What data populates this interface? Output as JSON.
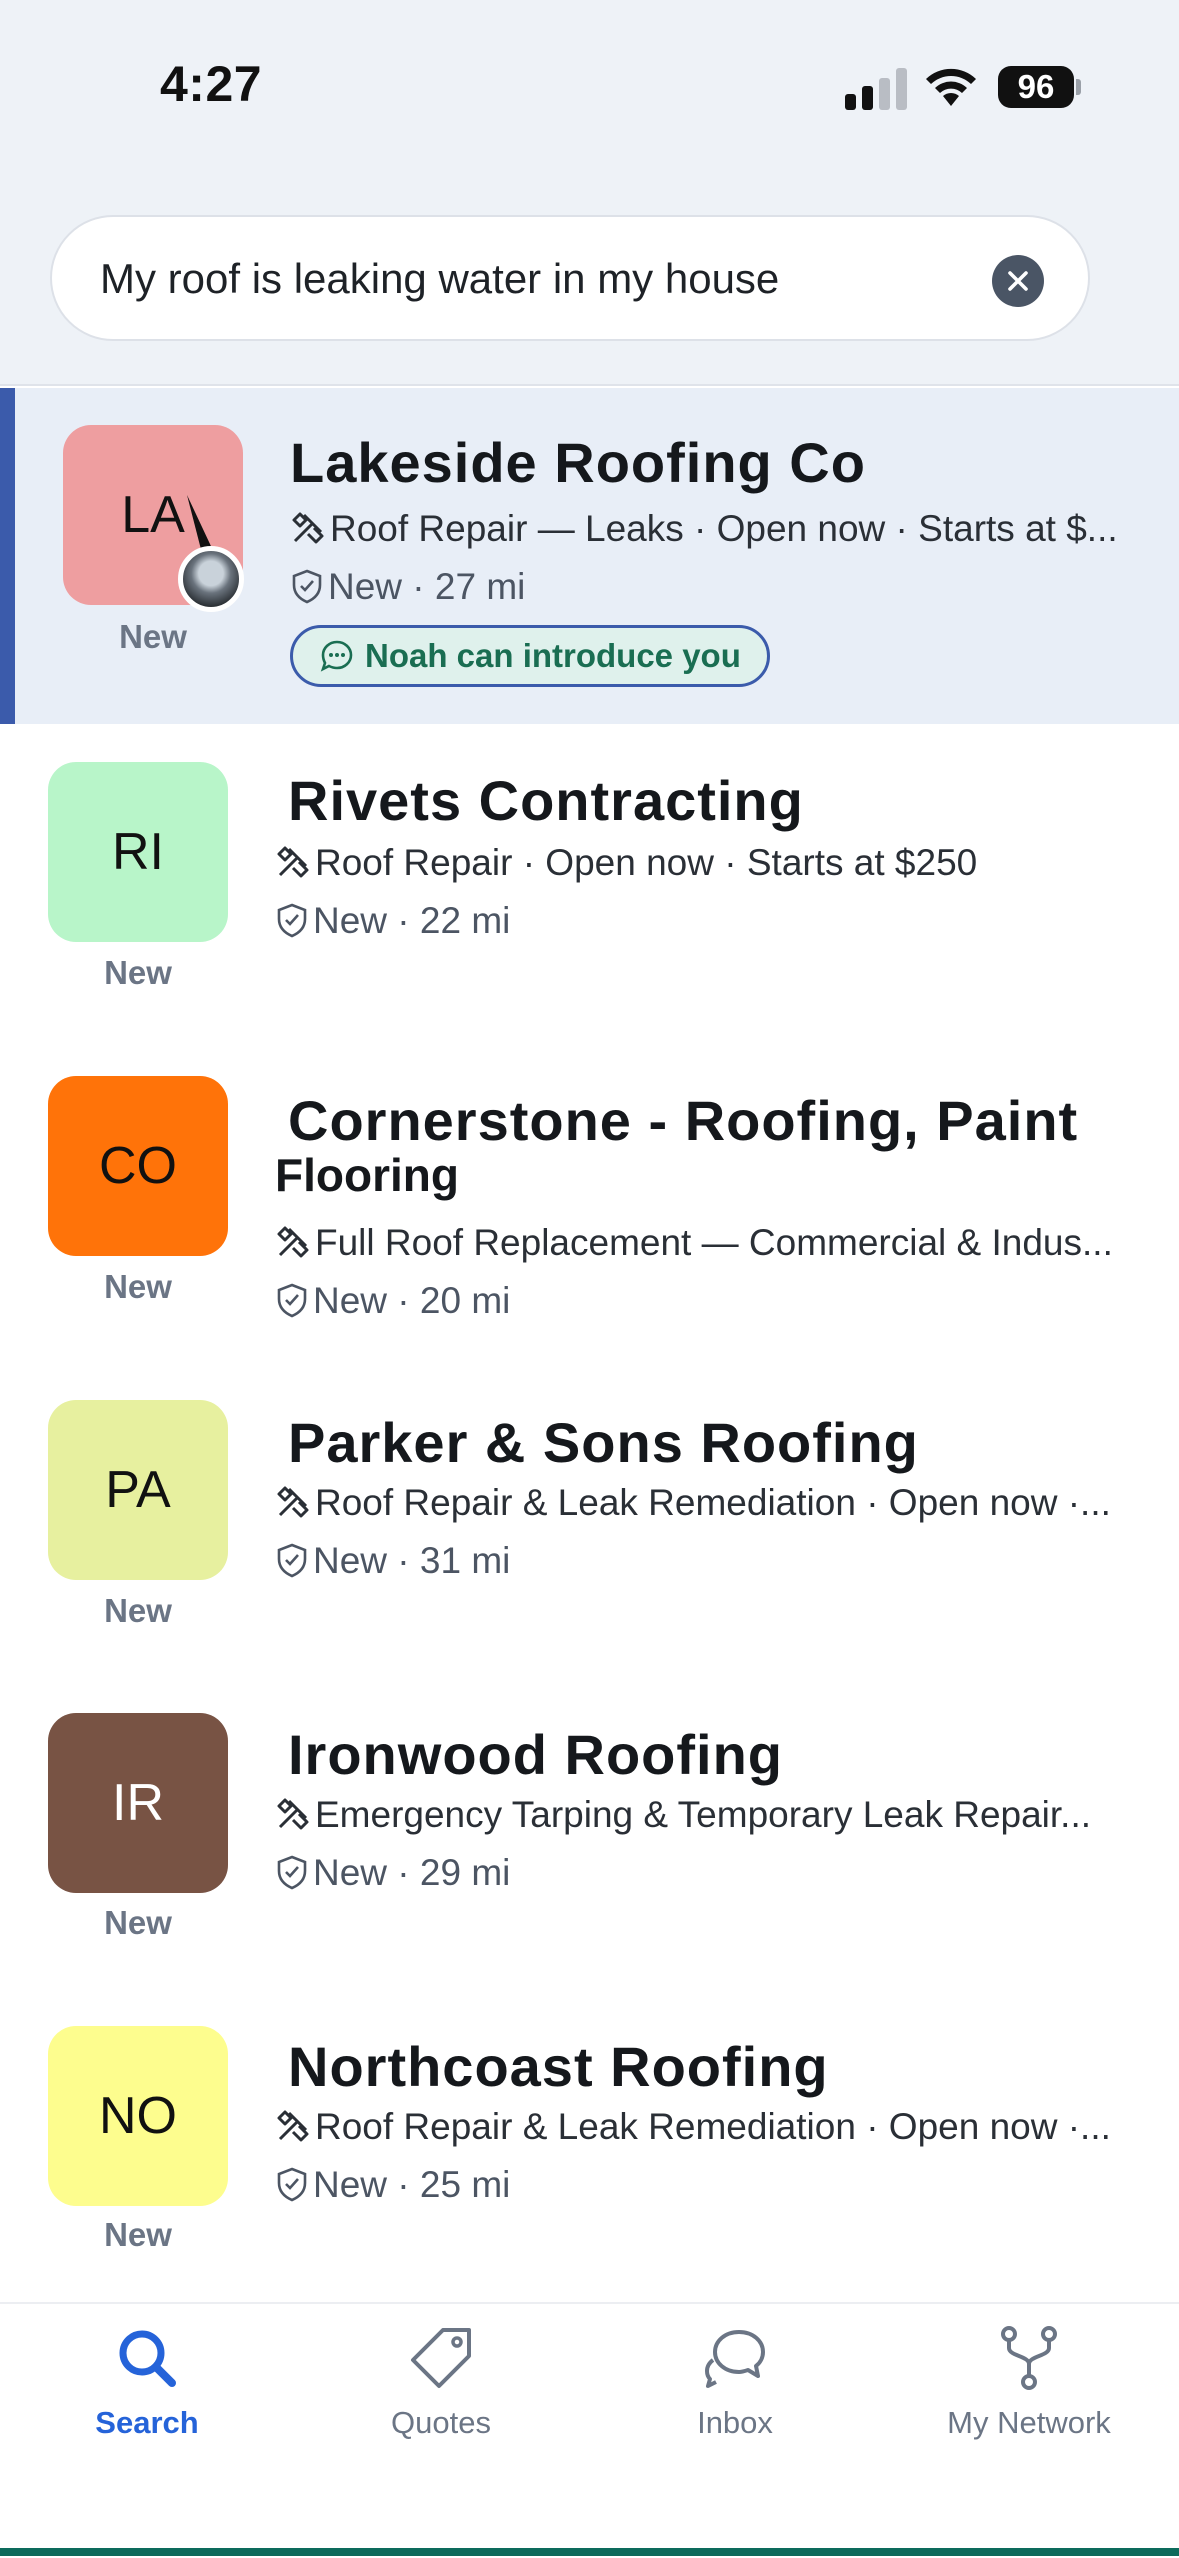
{
  "status_bar": {
    "time": "4:27",
    "battery": "96"
  },
  "search": {
    "query": "My roof is leaking water in my house"
  },
  "results": [
    {
      "initials": "LA",
      "avatar_color": "#ee9ea0",
      "name": "Lakeside Roofing Co",
      "services": "Roof Repair — Leaks · Open now · Starts at $...",
      "meta": "New · 27 mi",
      "badge": "New",
      "intro": "Noah can introduce you"
    },
    {
      "initials": "RI",
      "avatar_color": "#b8f5c9",
      "name": "Rivets Contracting",
      "services": "Roof Repair · Open now · Starts at $250",
      "meta": "New · 22 mi",
      "badge": "New"
    },
    {
      "initials": "CO",
      "avatar_color": "#ff7309",
      "name": "Cornerstone - Roofing, Paint",
      "name_cont": "Flooring",
      "services": "Full Roof Replacement — Commercial & Indus...",
      "meta": "New · 20 mi",
      "badge": "New"
    },
    {
      "initials": "PA",
      "avatar_color": "#e7f09f",
      "name": "Parker & Sons Roofing",
      "services": "Roof Repair & Leak Remediation · Open now ·...",
      "meta": "New · 31 mi",
      "badge": "New"
    },
    {
      "initials": "IR",
      "avatar_color": "#785344",
      "name": "Ironwood Roofing",
      "services": "Emergency Tarping & Temporary Leak Repair...",
      "meta": "New · 29 mi",
      "badge": "New"
    },
    {
      "initials": "NO",
      "avatar_color": "#fdfd8e",
      "name": "Northcoast Roofing",
      "services": "Roof Repair & Leak Remediation · Open now ·...",
      "meta": "New · 25 mi",
      "badge": "New"
    }
  ],
  "tabs": [
    {
      "label": "Search",
      "icon": "search-icon",
      "active": true
    },
    {
      "label": "Quotes",
      "icon": "tag-icon",
      "active": false
    },
    {
      "label": "Inbox",
      "icon": "chat-bubbles-icon",
      "active": false
    },
    {
      "label": "My Network",
      "icon": "network-fork-icon",
      "active": false
    }
  ],
  "colors": {
    "accent": "#2563d9",
    "highlight_bar": "#3b5bab",
    "intro_text": "#1a6e52"
  }
}
